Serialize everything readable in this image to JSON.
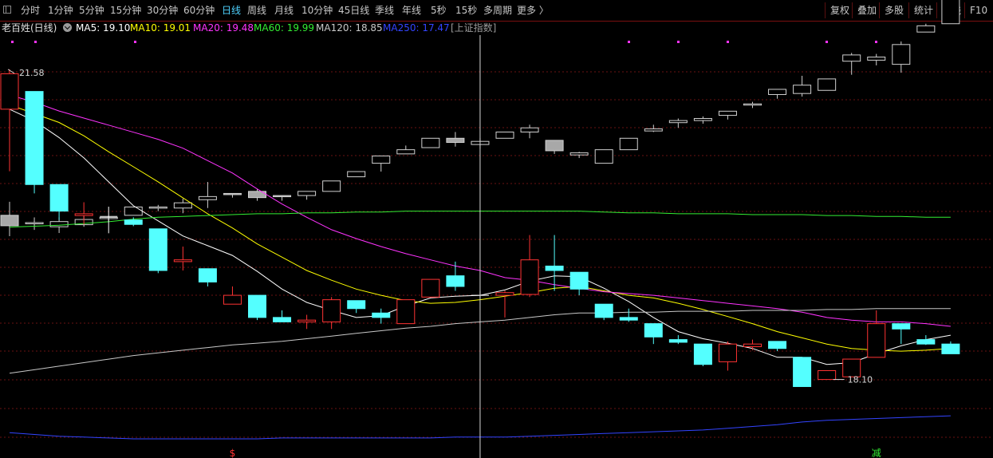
{
  "toolbar": {
    "periods": [
      "分时",
      "1分钟",
      "5分钟",
      "15分钟",
      "30分钟",
      "60分钟",
      "日线",
      "周线",
      "月线",
      "10分钟",
      "45日线",
      "季线",
      "年线",
      "5秒",
      "15秒",
      "多周期",
      "更多 〉"
    ],
    "active_period": "日线",
    "right_buttons": [
      "复权",
      "叠加",
      "多股",
      "统计",
      "画线",
      "F10"
    ]
  },
  "infobar": {
    "stock_name": "老百姓(日线)",
    "ma_items": [
      {
        "label": "MA5: 19.10",
        "color": "#ffffff"
      },
      {
        "label": "MA10: 19.01",
        "color": "#ffff00"
      },
      {
        "label": "MA20: 19.48",
        "color": "#ff33ff"
      },
      {
        "label": "MA60: 19.99",
        "color": "#33ee33"
      },
      {
        "label": "MA120: 18.85",
        "color": "#c8c8c8"
      },
      {
        "label": "MA250: 17.47",
        "color": "#3344ff"
      }
    ],
    "overlay_label": "[上证指数]"
  },
  "chart_data": {
    "type": "candlestick",
    "title": "老百姓(日线)",
    "main_ylim": [
      17.2,
      21.9
    ],
    "index_ylim": [
      3180,
      3580
    ],
    "high_label": "21.58",
    "low_label": "18.10",
    "bottom_markers": [
      {
        "index": 9,
        "text": "$",
        "color": "#ff3333"
      },
      {
        "index": 35,
        "text": "减",
        "color": "#33ee33"
      }
    ],
    "crosshair_index": 19,
    "candles": [
      {
        "o": 21.1,
        "h": 21.55,
        "l": 20.4,
        "c": 21.5
      },
      {
        "o": 21.3,
        "h": 21.3,
        "l": 20.15,
        "c": 20.25
      },
      {
        "o": 20.25,
        "h": 20.25,
        "l": 19.85,
        "c": 19.95
      },
      {
        "o": 19.9,
        "h": 20.05,
        "l": 19.8,
        "c": 19.92
      },
      {
        "o": 19.9,
        "h": 20.0,
        "l": 19.7,
        "c": 19.89
      },
      {
        "o": 19.85,
        "h": 19.88,
        "l": 19.78,
        "c": 19.8
      },
      {
        "o": 19.75,
        "h": 19.75,
        "l": 19.25,
        "c": 19.28
      },
      {
        "o": 19.38,
        "h": 19.55,
        "l": 19.28,
        "c": 19.4
      },
      {
        "o": 19.3,
        "h": 19.3,
        "l": 19.1,
        "c": 19.15
      },
      {
        "o": 18.9,
        "h": 19.1,
        "l": 18.9,
        "c": 19.0
      },
      {
        "o": 19.0,
        "h": 19.0,
        "l": 18.72,
        "c": 18.75
      },
      {
        "o": 18.75,
        "h": 18.83,
        "l": 18.7,
        "c": 18.7
      },
      {
        "o": 18.7,
        "h": 18.78,
        "l": 18.62,
        "c": 18.72
      },
      {
        "o": 18.7,
        "h": 18.98,
        "l": 18.62,
        "c": 18.95
      },
      {
        "o": 18.94,
        "h": 18.94,
        "l": 18.8,
        "c": 18.85
      },
      {
        "o": 18.8,
        "h": 18.85,
        "l": 18.68,
        "c": 18.75
      },
      {
        "o": 18.68,
        "h": 18.95,
        "l": 18.68,
        "c": 18.95
      },
      {
        "o": 18.98,
        "h": 19.18,
        "l": 18.98,
        "c": 19.18
      },
      {
        "o": 19.22,
        "h": 19.38,
        "l": 19.05,
        "c": 19.1
      },
      {
        "o": 19.0,
        "h": 19.05,
        "l": 18.95,
        "c": 19.0
      },
      {
        "o": 19.0,
        "h": 19.05,
        "l": 18.75,
        "c": 19.03
      },
      {
        "o": 19.01,
        "h": 19.68,
        "l": 18.98,
        "c": 19.4
      },
      {
        "o": 19.33,
        "h": 19.68,
        "l": 19.05,
        "c": 19.28
      },
      {
        "o": 19.26,
        "h": 19.26,
        "l": 19.0,
        "c": 19.07
      },
      {
        "o": 18.9,
        "h": 18.9,
        "l": 18.72,
        "c": 18.75
      },
      {
        "o": 18.75,
        "h": 18.85,
        "l": 18.7,
        "c": 18.72
      },
      {
        "o": 18.68,
        "h": 18.68,
        "l": 18.45,
        "c": 18.53
      },
      {
        "o": 18.5,
        "h": 18.55,
        "l": 18.45,
        "c": 18.47
      },
      {
        "o": 18.45,
        "h": 18.45,
        "l": 18.2,
        "c": 18.22
      },
      {
        "o": 18.25,
        "h": 18.48,
        "l": 18.15,
        "c": 18.45
      },
      {
        "o": 18.42,
        "h": 18.5,
        "l": 18.38,
        "c": 18.45
      },
      {
        "o": 18.48,
        "h": 18.48,
        "l": 18.37,
        "c": 18.4
      },
      {
        "o": 18.3,
        "h": 18.3,
        "l": 18.1,
        "c": 17.97
      },
      {
        "o": 18.05,
        "h": 18.15,
        "l": 18.05,
        "c": 18.15
      },
      {
        "o": 18.08,
        "h": 18.28,
        "l": 18.08,
        "c": 18.28
      },
      {
        "o": 18.3,
        "h": 18.83,
        "l": 18.3,
        "c": 18.68
      },
      {
        "o": 18.68,
        "h": 18.68,
        "l": 18.45,
        "c": 18.62
      },
      {
        "o": 18.5,
        "h": 18.55,
        "l": 18.44,
        "c": 18.45
      },
      {
        "o": 18.45,
        "h": 18.48,
        "l": 18.35,
        "c": 18.34
      }
    ],
    "index_candles": [
      {
        "o": 3410,
        "h": 3423,
        "l": 3390,
        "c": 3400
      },
      {
        "o": 3403,
        "h": 3408,
        "l": 3396,
        "c": 3403
      },
      {
        "o": 3399,
        "h": 3408,
        "l": 3393,
        "c": 3404
      },
      {
        "o": 3401,
        "h": 3412,
        "l": 3399,
        "c": 3406
      },
      {
        "o": 3407,
        "h": 3409,
        "l": 3404,
        "c": 3408
      },
      {
        "o": 3410,
        "h": 3418,
        "l": 3410,
        "c": 3418
      },
      {
        "o": 3417,
        "h": 3420,
        "l": 3414,
        "c": 3418
      },
      {
        "o": 3417,
        "h": 3426,
        "l": 3412,
        "c": 3422
      },
      {
        "o": 3425,
        "h": 3442,
        "l": 3417,
        "c": 3428
      },
      {
        "o": 3431,
        "h": 3431,
        "l": 3427,
        "c": 3430
      },
      {
        "o": 3433,
        "h": 3435,
        "l": 3424,
        "c": 3427
      },
      {
        "o": 3429,
        "h": 3429,
        "l": 3424,
        "c": 3428
      },
      {
        "o": 3429,
        "h": 3431,
        "l": 3425,
        "c": 3433
      },
      {
        "o": 3433,
        "h": 3443,
        "l": 3433,
        "c": 3443
      },
      {
        "o": 3447,
        "h": 3452,
        "l": 3447,
        "c": 3452
      },
      {
        "o": 3460,
        "h": 3465,
        "l": 3452,
        "c": 3467
      },
      {
        "o": 3469,
        "h": 3477,
        "l": 3469,
        "c": 3473
      },
      {
        "o": 3475,
        "h": 3484,
        "l": 3475,
        "c": 3484
      },
      {
        "o": 3484,
        "h": 3490,
        "l": 3476,
        "c": 3480
      },
      {
        "o": 3478,
        "h": 3484,
        "l": 3474,
        "c": 3481
      },
      {
        "o": 3484,
        "h": 3490,
        "l": 3484,
        "c": 3490
      },
      {
        "o": 3490,
        "h": 3497,
        "l": 3484,
        "c": 3494
      },
      {
        "o": 3482,
        "h": 3482,
        "l": 3469,
        "c": 3472
      },
      {
        "o": 3468,
        "h": 3471,
        "l": 3465,
        "c": 3470
      },
      {
        "o": 3460,
        "h": 3473,
        "l": 3460,
        "c": 3473
      },
      {
        "o": 3473,
        "h": 3484,
        "l": 3473,
        "c": 3484
      },
      {
        "o": 3491,
        "h": 3497,
        "l": 3490,
        "c": 3493
      },
      {
        "o": 3499,
        "h": 3503,
        "l": 3494,
        "c": 3501
      },
      {
        "o": 3501,
        "h": 3505,
        "l": 3498,
        "c": 3503
      },
      {
        "o": 3506,
        "h": 3507,
        "l": 3502,
        "c": 3510
      },
      {
        "o": 3517,
        "h": 3519,
        "l": 3513,
        "c": 3517
      },
      {
        "o": 3526,
        "h": 3529,
        "l": 3522,
        "c": 3531
      },
      {
        "o": 3527,
        "h": 3544,
        "l": 3524,
        "c": 3535
      },
      {
        "o": 3530,
        "h": 3541,
        "l": 3530,
        "c": 3541
      },
      {
        "o": 3558,
        "h": 3566,
        "l": 3545,
        "c": 3564
      },
      {
        "o": 3559,
        "h": 3565,
        "l": 3554,
        "c": 3562
      },
      {
        "o": 3555,
        "h": 3577,
        "l": 3547,
        "c": 3574
      },
      {
        "o": 3586,
        "h": 3594,
        "l": 3586,
        "c": 3592
      },
      {
        "o": 3594,
        "h": 3626,
        "l": 3594,
        "c": 3621
      }
    ],
    "ma_lines": [
      {
        "name": "MA5",
        "color": "#ffffff",
        "values": [
          21.1,
          20.97,
          20.78,
          20.55,
          20.28,
          20.01,
          19.84,
          19.67,
          19.56,
          19.45,
          19.27,
          19.07,
          18.92,
          18.83,
          18.75,
          18.77,
          18.88,
          18.97,
          18.99,
          19.0,
          19.06,
          19.16,
          19.22,
          19.21,
          19.08,
          18.93,
          18.75,
          18.59,
          18.51,
          18.46,
          18.4,
          18.3,
          18.3,
          18.22,
          18.24,
          18.34,
          18.43,
          18.5,
          18.55
        ]
      },
      {
        "name": "MA10",
        "color": "#ffff00",
        "values": [
          21.15,
          21.05,
          20.95,
          20.8,
          20.62,
          20.45,
          20.28,
          20.1,
          19.92,
          19.76,
          19.58,
          19.43,
          19.28,
          19.17,
          19.07,
          19.0,
          18.94,
          18.91,
          18.92,
          18.95,
          18.99,
          19.03,
          19.08,
          19.1,
          19.05,
          19.0,
          18.97,
          18.91,
          18.84,
          18.76,
          18.68,
          18.59,
          18.52,
          18.45,
          18.4,
          18.38,
          18.37,
          18.38,
          18.4
        ]
      },
      {
        "name": "MA20",
        "color": "#ff33ff",
        "values": [
          21.26,
          21.18,
          21.08,
          21.0,
          20.92,
          20.84,
          20.76,
          20.66,
          20.52,
          20.38,
          20.2,
          20.03,
          19.88,
          19.74,
          19.64,
          19.55,
          19.47,
          19.4,
          19.33,
          19.28,
          19.2,
          19.17,
          19.12,
          19.08,
          19.04,
          19.02,
          19.0,
          18.97,
          18.94,
          18.91,
          18.88,
          18.85,
          18.81,
          18.75,
          18.72,
          18.7,
          18.7,
          18.68,
          18.65
        ]
      },
      {
        "name": "MA60",
        "color": "#33ee33",
        "values": [
          19.77,
          19.78,
          19.79,
          19.81,
          19.83,
          19.86,
          19.88,
          19.89,
          19.9,
          19.91,
          19.92,
          19.92,
          19.93,
          19.93,
          19.94,
          19.94,
          19.95,
          19.95,
          19.95,
          19.95,
          19.95,
          19.95,
          19.95,
          19.95,
          19.94,
          19.93,
          19.93,
          19.92,
          19.92,
          19.92,
          19.91,
          19.91,
          19.91,
          19.9,
          19.9,
          19.89,
          19.89,
          19.88,
          19.88
        ]
      },
      {
        "name": "MA120",
        "color": "#c8c8c8",
        "values": [
          18.12,
          18.16,
          18.2,
          18.24,
          18.28,
          18.32,
          18.35,
          18.38,
          18.41,
          18.44,
          18.46,
          18.48,
          18.51,
          18.54,
          18.57,
          18.6,
          18.63,
          18.65,
          18.68,
          18.7,
          18.72,
          18.75,
          18.78,
          18.8,
          18.8,
          18.81,
          18.81,
          18.82,
          18.82,
          18.82,
          18.83,
          18.83,
          18.83,
          18.84,
          18.84,
          18.85,
          18.85,
          18.85,
          18.85
        ]
      },
      {
        "name": "MA250",
        "color": "#3344ff",
        "values": [
          17.45,
          17.43,
          17.41,
          17.4,
          17.39,
          17.38,
          17.38,
          17.38,
          17.38,
          17.38,
          17.38,
          17.39,
          17.39,
          17.39,
          17.39,
          17.39,
          17.39,
          17.39,
          17.4,
          17.4,
          17.4,
          17.41,
          17.42,
          17.43,
          17.44,
          17.45,
          17.46,
          17.47,
          17.48,
          17.5,
          17.52,
          17.54,
          17.57,
          17.59,
          17.6,
          17.61,
          17.62,
          17.63,
          17.64
        ]
      }
    ]
  }
}
